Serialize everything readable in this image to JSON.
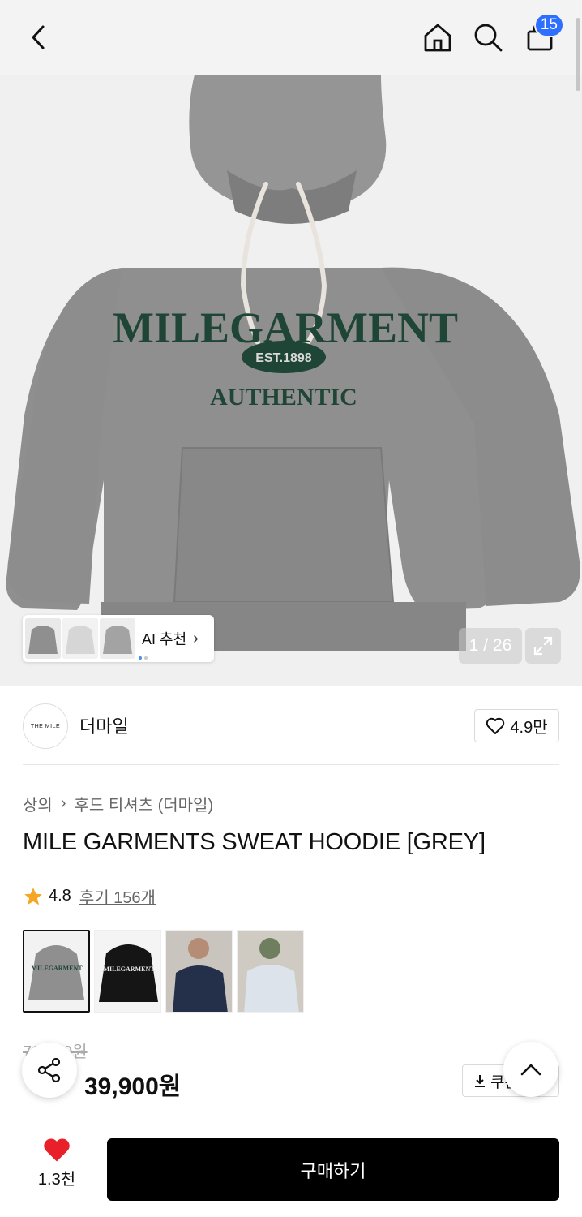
{
  "nav": {
    "cart_count": "15"
  },
  "hero": {
    "ai_label": "AI 추천",
    "counter": "1 / 26"
  },
  "brand": {
    "logo_text": "THE MILÉ",
    "name": "더마일",
    "likes": "4.9만"
  },
  "breadcrumb": {
    "category": "상의",
    "sub": "후드 티셔츠 (더마일)"
  },
  "product": {
    "title": "MILE GARMENTS SWEAT HOODIE [GREY]",
    "rating": "4.8",
    "reviews": "후기 156개",
    "original_price": "79,900원",
    "price": "39,900원",
    "coupon": "쿠폰"
  },
  "bottom": {
    "fav_count": "1.3천",
    "buy_label": "구매하기"
  },
  "colors": {
    "accent": "#2f6fff",
    "heart": "#e8202a",
    "star": "#f5a623",
    "sale": "#ff3b30",
    "print": "#1f4536"
  }
}
